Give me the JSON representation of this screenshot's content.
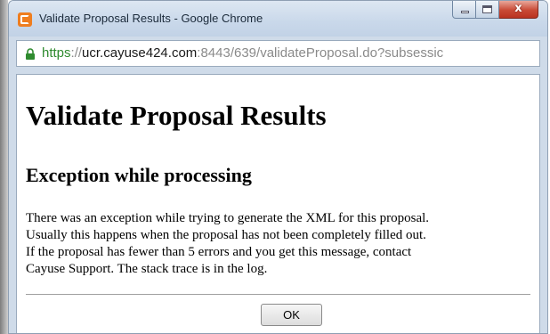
{
  "window": {
    "title": "Validate Proposal Results - Google Chrome",
    "close_glyph": "x"
  },
  "address_bar": {
    "scheme": "https",
    "separator": "://",
    "host": "ucr.cayuse424.com",
    "rest": ":8443/639/validateProposal.do?subsessic",
    "icon": "lock-icon"
  },
  "page": {
    "title": "Validate Proposal Results",
    "section_title": "Exception while processing",
    "message_lines": [
      "There was an exception while trying to generate the XML for this proposal.",
      "Usually this happens when the proposal has not been completely filled out.",
      "If the proposal has fewer than 5 errors and you get this message, contact",
      "Cayuse Support. The stack trace is in the log."
    ],
    "ok_label": "OK"
  }
}
